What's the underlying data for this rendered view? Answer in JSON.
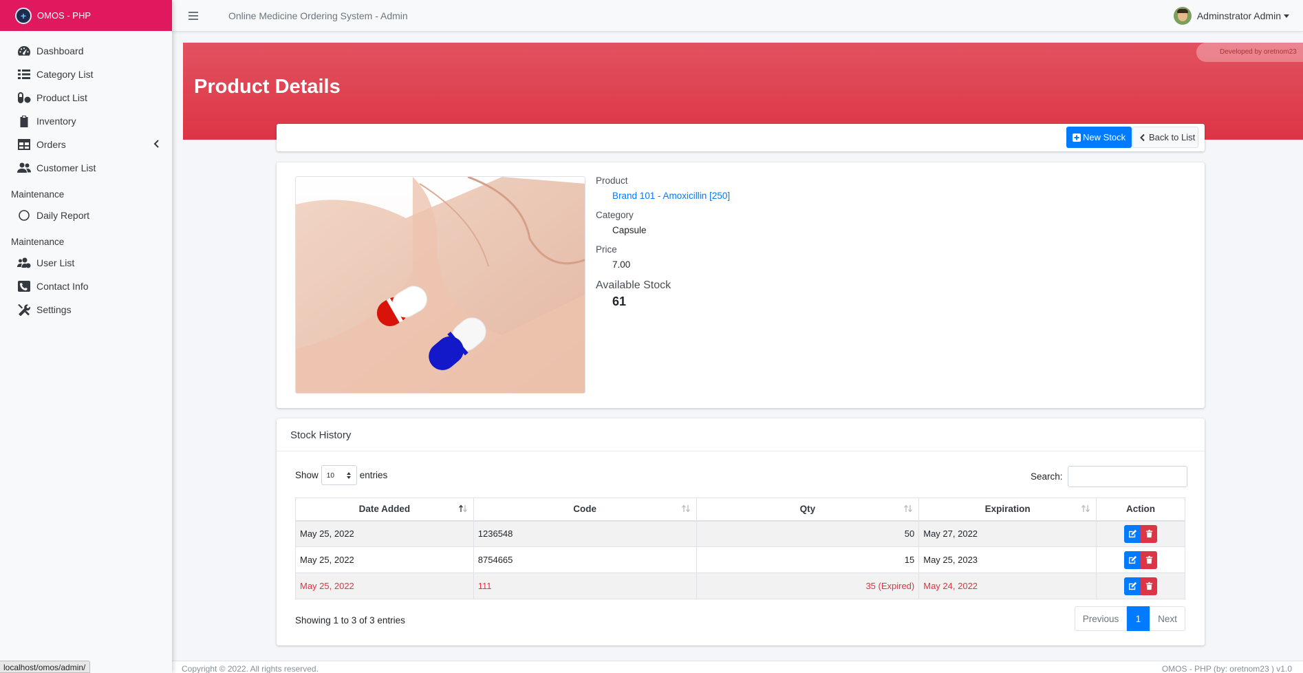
{
  "app": {
    "brand": "OMOS - PHP",
    "system_title": "Online Medicine Ordering System - Admin"
  },
  "sidebar": {
    "items": [
      {
        "label": "Dashboard",
        "icon": "tachometer-icon"
      },
      {
        "label": "Category List",
        "icon": "list-icon"
      },
      {
        "label": "Product List",
        "icon": "pills-icon"
      },
      {
        "label": "Inventory",
        "icon": "clipboard-icon"
      },
      {
        "label": "Orders",
        "icon": "table-icon"
      },
      {
        "label": "Customer List",
        "icon": "users-icon"
      }
    ],
    "section1": {
      "header": "Maintenance",
      "items": [
        {
          "label": "Daily Report",
          "icon": "circle-icon"
        }
      ]
    },
    "section2": {
      "header": "Maintenance",
      "items": [
        {
          "label": "User List",
          "icon": "users-cog-icon"
        },
        {
          "label": "Contact Info",
          "icon": "phone-square-icon"
        },
        {
          "label": "Settings",
          "icon": "tools-icon"
        }
      ]
    }
  },
  "user": {
    "name": "Adminstrator Admin"
  },
  "page": {
    "title": "Product Details",
    "developer_badge": "Developed by oretnom23"
  },
  "actions": {
    "new_stock": "New Stock",
    "back": "Back to List"
  },
  "product": {
    "product_label": "Product",
    "product_value": "Brand 101 - Amoxicillin [250]",
    "category_label": "Category",
    "category_value": "Capsule",
    "price_label": "Price",
    "price_value": "7.00",
    "stock_label": "Available Stock",
    "stock_value": "61"
  },
  "history": {
    "title": "Stock History",
    "show": "Show",
    "entries_value": "10",
    "entries": "entries",
    "search_label": "Search:",
    "search_value": "",
    "columns": [
      "Date Added",
      "Code",
      "Qty",
      "Expiration",
      "Action"
    ],
    "rows": [
      {
        "date": "May 25, 2022",
        "code": "1236548",
        "qty": "50",
        "expiration": "May 27, 2022"
      },
      {
        "date": "May 25, 2022",
        "code": "8754665",
        "qty": "15",
        "expiration": "May 25, 2023"
      },
      {
        "date": "May 25, 2022",
        "code": "111",
        "qty": "35 (Expired)",
        "expiration": "May 24, 2022"
      }
    ],
    "info": "Showing 1 to 3 of 3 entries",
    "pager": {
      "previous": "Previous",
      "current": "1",
      "next": "Next"
    }
  },
  "footer": {
    "left": "Copyright © 2022. All rights reserved.",
    "right": "OMOS - PHP (by: oretnom23 ) v1.0"
  },
  "status_url": "localhost/omos/admin/",
  "colors": {
    "brand": "#e0195f",
    "banner": "#dc3545",
    "primary": "#007bff",
    "danger": "#dc3545"
  }
}
